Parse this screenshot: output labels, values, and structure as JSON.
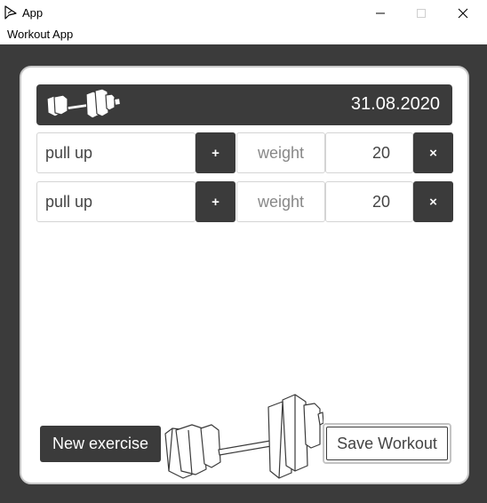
{
  "window": {
    "title": "App",
    "icon": "app-arrow-icon",
    "controls": [
      "minimize-icon",
      "maximize-icon",
      "close-icon"
    ]
  },
  "menu": {
    "items": [
      {
        "label": "Workout App"
      }
    ]
  },
  "header": {
    "logo": "dumbbell-icon",
    "date": "31.08.2020"
  },
  "exercises": [
    {
      "name": "pull up",
      "add_label": "+",
      "weight_placeholder": "weight",
      "value": "20",
      "remove_label": "×"
    },
    {
      "name": "pull up",
      "add_label": "+",
      "weight_placeholder": "weight",
      "value": "20",
      "remove_label": "×"
    }
  ],
  "actions": {
    "new_exercise_label": "New exercise",
    "save_label": "Save Workout"
  },
  "colors": {
    "dark": "#3b3b3b",
    "card": "#ffffff",
    "border": "#c9c9c9"
  }
}
